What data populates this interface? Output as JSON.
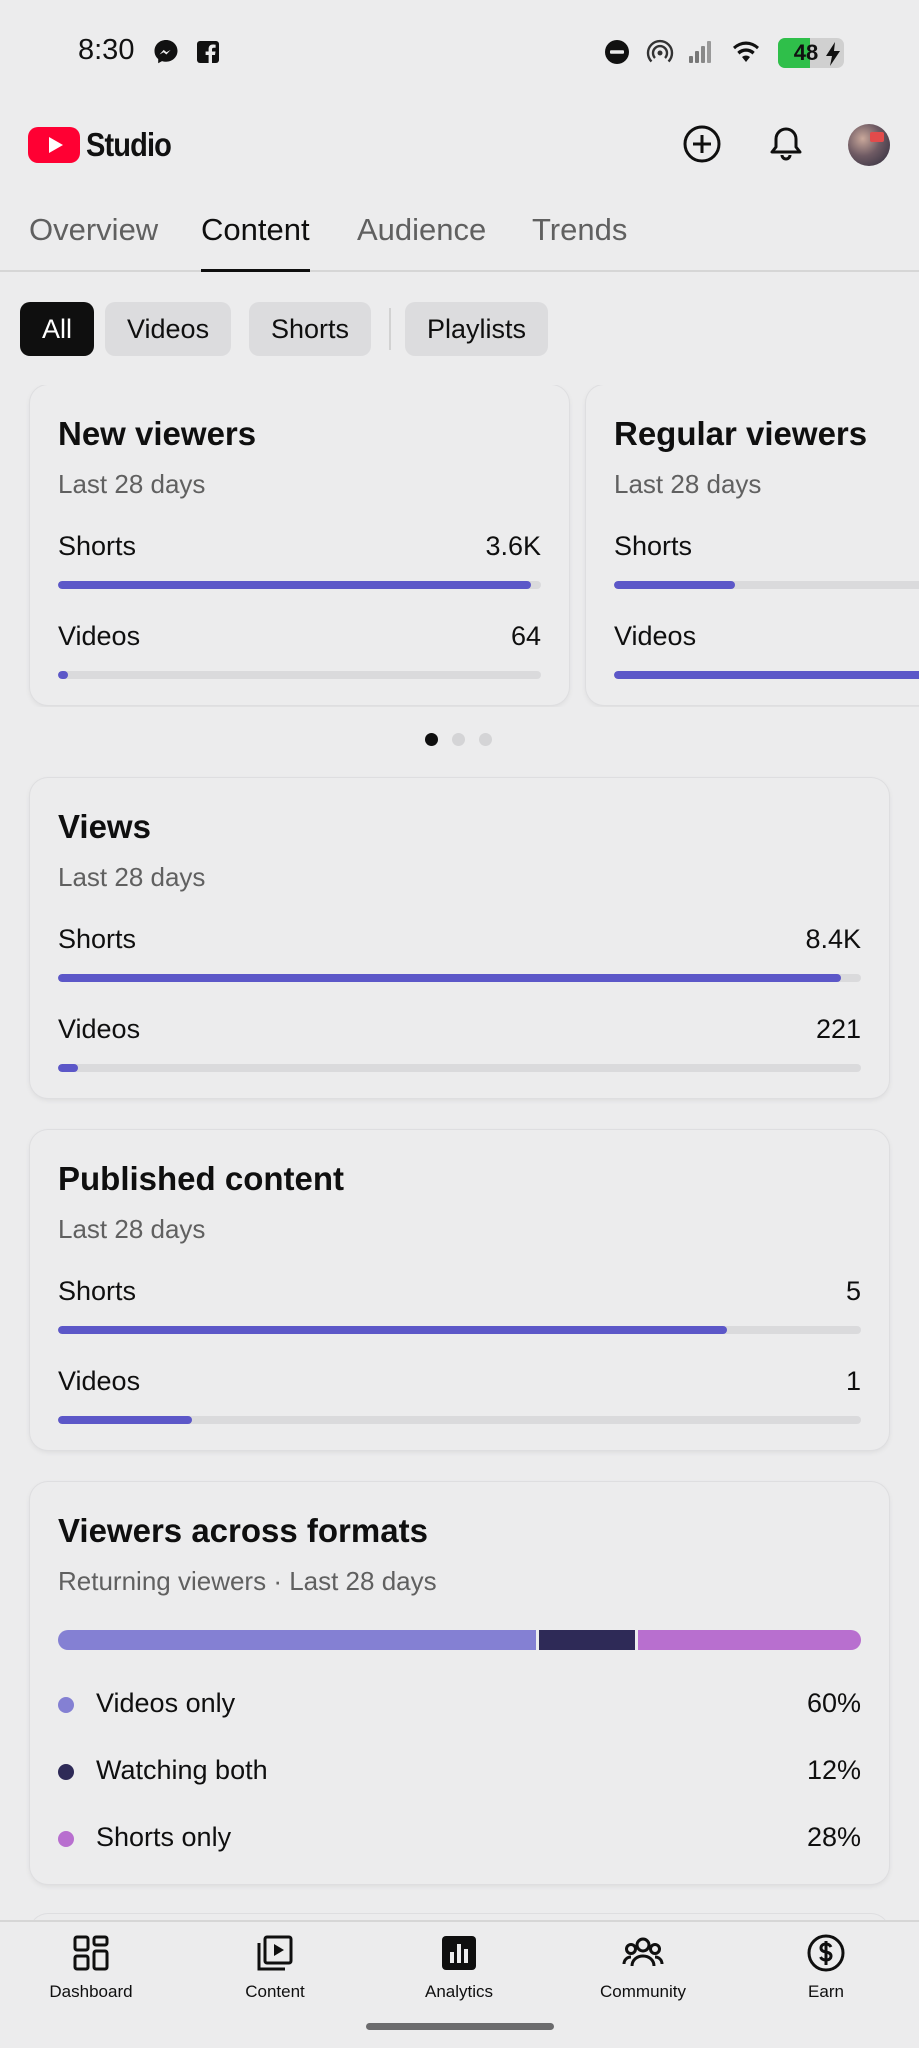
{
  "status_bar": {
    "time": "8:30",
    "battery_level": 48,
    "battery_label": "48",
    "icons": [
      "messenger-icon",
      "facebook-icon",
      "do-not-disturb-icon",
      "hotspot-icon",
      "signal-icon",
      "wifi-icon",
      "charging-bolt-icon"
    ]
  },
  "header": {
    "logo_text": "Studio",
    "icons": [
      "create-icon",
      "bell-icon"
    ],
    "accent_color": "#ff0033"
  },
  "tabs": [
    {
      "label": "Overview",
      "active": false
    },
    {
      "label": "Content",
      "active": true
    },
    {
      "label": "Audience",
      "active": false
    },
    {
      "label": "Trends",
      "active": false
    }
  ],
  "chips": [
    {
      "label": "All",
      "active": true
    },
    {
      "label": "Videos",
      "active": false
    },
    {
      "label": "Shorts",
      "active": false
    },
    {
      "label": "Playlists",
      "active": false
    }
  ],
  "bar_color": "#5c57c8",
  "cards": {
    "new_viewers": {
      "title": "New viewers",
      "subtitle": "Last 28 days",
      "rows": [
        {
          "label": "Shorts",
          "value": "3.6K",
          "fraction": 0.98
        },
        {
          "label": "Videos",
          "value": "64",
          "fraction": 0.02
        }
      ]
    },
    "regular_viewers": {
      "title": "Regular viewers",
      "subtitle": "Last 28 days",
      "rows": [
        {
          "label": "Shorts",
          "fraction": 0.25
        },
        {
          "label": "Videos",
          "fraction": 1.0
        }
      ]
    },
    "views": {
      "title": "Views",
      "subtitle": "Last 28 days",
      "rows": [
        {
          "label": "Shorts",
          "value": "8.4K",
          "fraction": 0.975
        },
        {
          "label": "Videos",
          "value": "221",
          "fraction": 0.025
        }
      ]
    },
    "published": {
      "title": "Published content",
      "subtitle": "Last 28 days",
      "rows": [
        {
          "label": "Shorts",
          "value": "5",
          "fraction": 0.833
        },
        {
          "label": "Videos",
          "value": "1",
          "fraction": 0.167
        }
      ]
    },
    "formats": {
      "title": "Viewers across formats",
      "subtitle": "Returning viewers · Last 28 days",
      "segments": [
        {
          "label": "Videos only",
          "value": "60%",
          "percent": 60,
          "color": "#8480d3"
        },
        {
          "label": "Watching both",
          "value": "12%",
          "percent": 12,
          "color": "#2e2a57"
        },
        {
          "label": "Shorts only",
          "value": "28%",
          "percent": 28,
          "color": "#b86fcf"
        }
      ]
    }
  },
  "carousel": {
    "page_count": 3,
    "active_index": 0
  },
  "bottom_nav": [
    {
      "label": "Dashboard",
      "icon": "dashboard-icon"
    },
    {
      "label": "Content",
      "icon": "content-icon"
    },
    {
      "label": "Analytics",
      "icon": "analytics-icon",
      "active": true
    },
    {
      "label": "Community",
      "icon": "community-icon"
    },
    {
      "label": "Earn",
      "icon": "earn-icon"
    }
  ]
}
